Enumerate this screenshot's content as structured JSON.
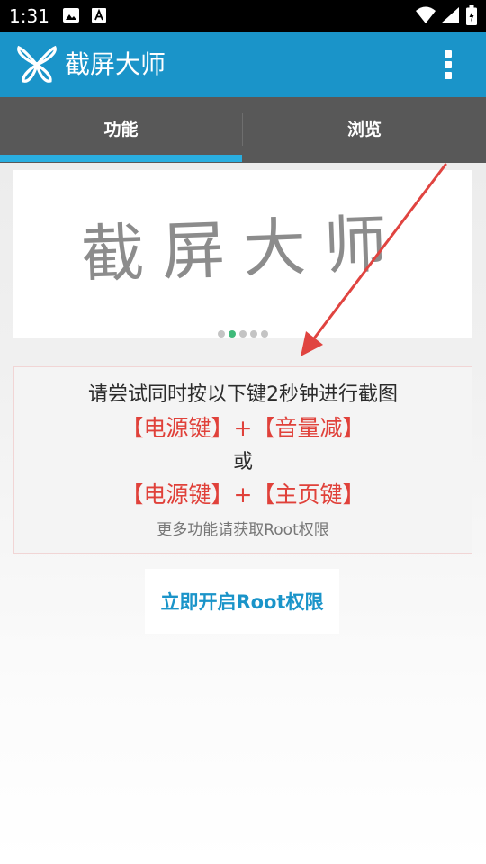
{
  "status_bar": {
    "time": "1:31",
    "icons": [
      "image-icon",
      "text-a-icon",
      "wifi-icon",
      "signal-icon",
      "battery-icon"
    ]
  },
  "app_bar": {
    "title": "截屏大师",
    "logo_icon": "scissors-propeller-logo",
    "menu_icon": "overflow-menu-icon",
    "color": "#1a94c9"
  },
  "tabs": [
    {
      "label": "功能",
      "selected": true
    },
    {
      "label": "浏览",
      "selected": false
    }
  ],
  "banner": {
    "text": "截屏大师",
    "dots": {
      "count": 5,
      "active_index": 1,
      "active_color": "#3fba7a"
    }
  },
  "instructions": {
    "line1": "请尝试同时按以下键2秒钟进行截图",
    "line2": "【电源键】+【音量减】",
    "or": "或",
    "line4": "【电源键】+【主页键】",
    "hint": "更多功能请获取Root权限",
    "highlight_color": "#e0413a"
  },
  "root_button": {
    "label": "立即开启Root权限"
  },
  "annotation": {
    "arrow_color": "#e04440"
  }
}
